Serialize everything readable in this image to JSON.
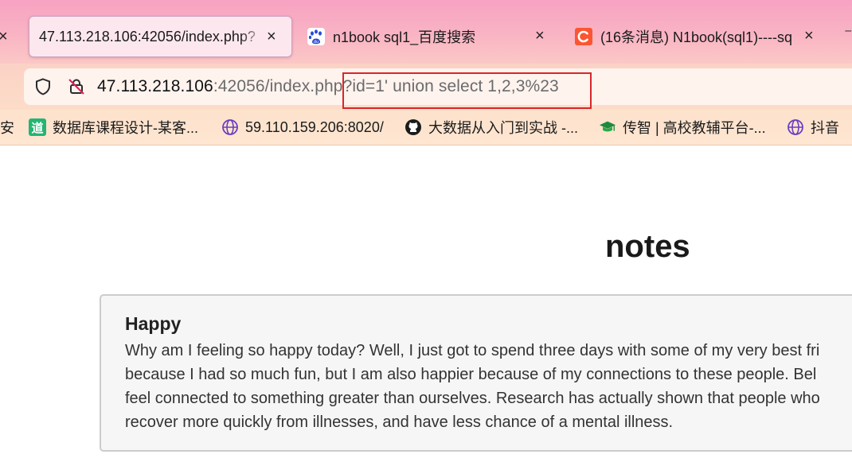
{
  "tabs": [
    {
      "title": "47.113.218.106:42056/index.php?",
      "favicon": "none",
      "active": true
    },
    {
      "title": "n1book sql1_百度搜索",
      "favicon": "baidu-paw-icon",
      "active": false
    },
    {
      "title": "(16条消息) N1book(sql1)----sq",
      "favicon": "csdn-c-icon",
      "active": false
    }
  ],
  "tab_close_glyph": "×",
  "address": {
    "host": "47.113.218.106",
    "rest": ":42056/index.php?id=1' union select 1,2,3%23"
  },
  "bookmarks": [
    {
      "label": "安",
      "icon": "none"
    },
    {
      "label": "数据库课程设计-某客...",
      "icon": "green-dao-icon"
    },
    {
      "label": "59.110.159.206:8020/",
      "icon": "globe-icon"
    },
    {
      "label": "大数据从入门到实战 -...",
      "icon": "github-icon"
    },
    {
      "label": "传智 | 高校教辅平台-...",
      "icon": "graduation-cap-icon"
    },
    {
      "label": "抖音",
      "icon": "globe-icon"
    }
  ],
  "page": {
    "title": "notes",
    "note": {
      "heading": "Happy",
      "lines": [
        "Why am I feeling so happy today? Well, I just got to spend three days with some of my very best fri",
        "because I had so much fun, but I am also happier because of my connections to these people. Bel",
        "feel connected to something greater than ourselves. Research has actually shown that people who",
        "recover more quickly from illnesses, and have less chance of a mental illness."
      ]
    }
  },
  "colors": {
    "tab_strip": "#f7a2c2",
    "active_tab": "#fde7ef",
    "url_bar": "#fff3ee",
    "highlight_border": "#d8262b",
    "card_bg": "#f6f6f6",
    "card_border": "#cccccc"
  }
}
